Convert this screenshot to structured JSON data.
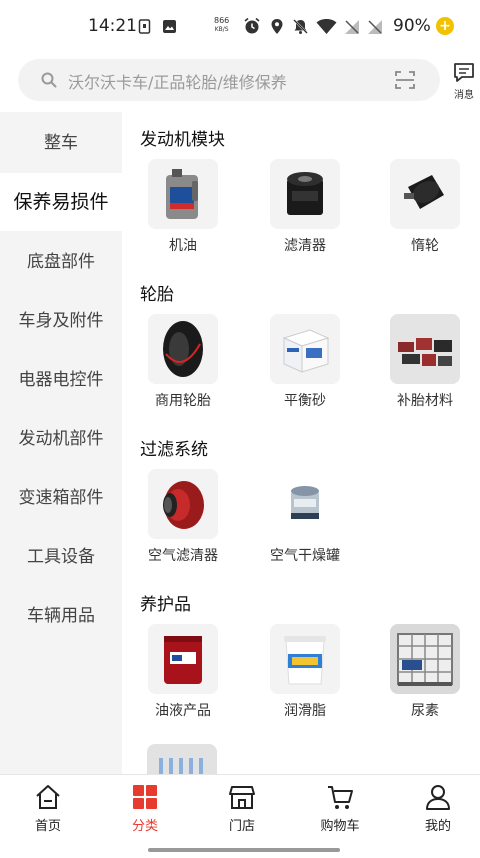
{
  "status_bar": {
    "time": "14:21",
    "net_speed": "866",
    "net_unit": "KB/S",
    "battery": "90%"
  },
  "search": {
    "placeholder": "沃尔沃卡车/正品轮胎/维修保养",
    "message_label": "消息"
  },
  "sidebar": {
    "items": [
      {
        "label": "整车"
      },
      {
        "label": "保养易损件"
      },
      {
        "label": "底盘部件"
      },
      {
        "label": "车身及附件"
      },
      {
        "label": "电器电控件"
      },
      {
        "label": "发动机部件"
      },
      {
        "label": "变速箱部件"
      },
      {
        "label": "工具设备"
      },
      {
        "label": "车辆用品"
      }
    ],
    "active_index": 1
  },
  "sections": [
    {
      "title": "发动机模块",
      "products": [
        {
          "label": "机油",
          "icon": "oil-bottle"
        },
        {
          "label": "滤清器",
          "icon": "oil-filter"
        },
        {
          "label": "惰轮",
          "icon": "idler-pulley"
        }
      ]
    },
    {
      "title": "轮胎",
      "products": [
        {
          "label": "商用轮胎",
          "icon": "tire"
        },
        {
          "label": "平衡砂",
          "icon": "balance-sand-box"
        },
        {
          "label": "补胎材料",
          "icon": "tire-repair-kit"
        }
      ]
    },
    {
      "title": "过滤系统",
      "products": [
        {
          "label": "空气滤清器",
          "icon": "air-filter"
        },
        {
          "label": "空气干燥罐",
          "icon": "air-dryer"
        }
      ]
    },
    {
      "title": "养护品",
      "products": [
        {
          "label": "油液产品",
          "icon": "oil-drum"
        },
        {
          "label": "润滑脂",
          "icon": "grease-bucket"
        },
        {
          "label": "尿素",
          "icon": "urea-tank"
        }
      ]
    }
  ],
  "bottom_nav": {
    "items": [
      {
        "label": "首页",
        "icon": "home-icon"
      },
      {
        "label": "分类",
        "icon": "category-icon"
      },
      {
        "label": "门店",
        "icon": "store-icon"
      },
      {
        "label": "购物车",
        "icon": "cart-icon"
      },
      {
        "label": "我的",
        "icon": "user-icon"
      }
    ],
    "active_index": 1
  },
  "colors": {
    "accent": "#e63b2e",
    "sidebar_bg": "#f4f4f4",
    "content_bg": "#ffffff"
  }
}
